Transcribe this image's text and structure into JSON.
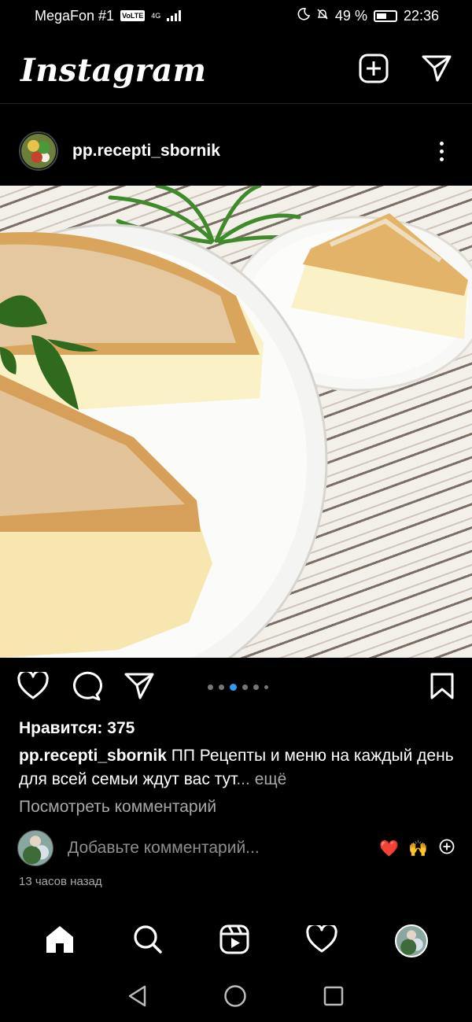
{
  "status_bar": {
    "carrier": "MegaFon #1",
    "volte": "VoLTE",
    "network": "4G",
    "battery": "49 %",
    "time": "22:36"
  },
  "header": {
    "brand": "Instagram",
    "new_post_icon": "plus-square-icon",
    "direct_icon": "paper-plane-icon"
  },
  "post": {
    "username": "pp.recepti_sbornik",
    "image_description_icon": "cake-photo",
    "likes": "Нравится: 375",
    "caption_username": "pp.recepti_sbornik",
    "caption_text": "ПП Рецепты и меню на каждый день для всей семьи ждут вас тут",
    "caption_ellipsis": "...",
    "caption_more": "ещё",
    "view_comments": "Посмотреть комментарий",
    "comment_placeholder": "Добавьте комментарий...",
    "emoji_heart": "❤️",
    "emoji_hands": "🙌",
    "timestamp": "13 часов назад",
    "carousel_active_index": 2,
    "carousel_count": 6
  },
  "colors": {
    "background": "#000000",
    "text": "#ffffff",
    "muted": "#a8a8a8",
    "carousel_active": "#3897f0"
  }
}
